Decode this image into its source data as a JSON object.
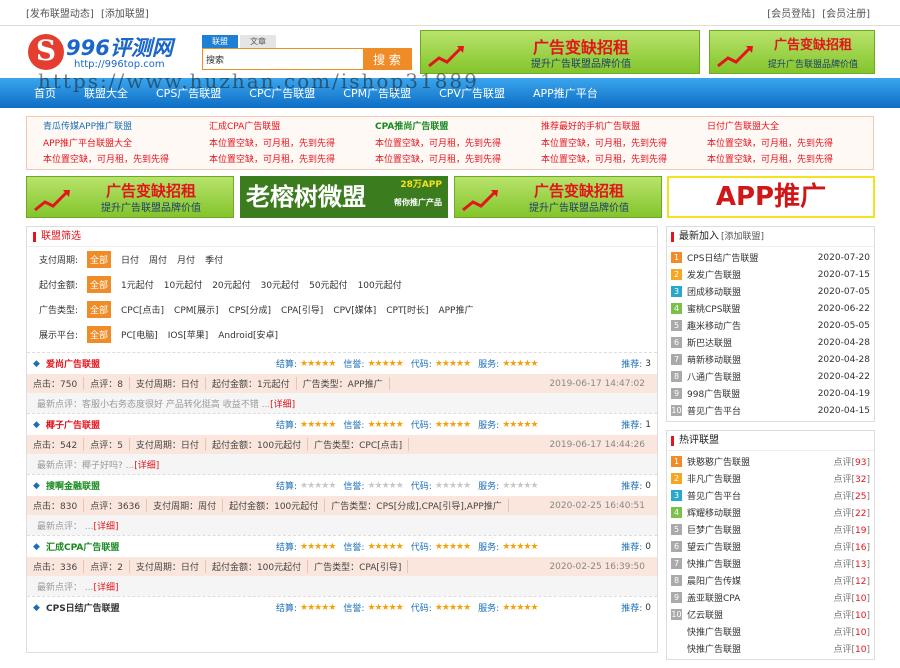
{
  "topbar": {
    "left": [
      "[发布联盟动态]",
      "[添加联盟]"
    ],
    "right": [
      "[会员登陆]",
      "[会员注册]"
    ]
  },
  "logo": {
    "mark": "S",
    "name": "996评测网",
    "url": "http://996top.com"
  },
  "search": {
    "tabs": [
      "联盟",
      "文章"
    ],
    "value": "搜索",
    "button": "搜 索"
  },
  "banner": {
    "title": "广告变缺招租",
    "subtitle": "提升广告联盟品牌价值"
  },
  "nav": {
    "items": [
      "首页",
      "联盟大全",
      "CPS广告联盟",
      "CPC广告联盟",
      "CPM广告联盟",
      "CPV广告联盟",
      "APP推广平台"
    ],
    "watermark": "https://www.huzhan.com/ishop31889"
  },
  "links": [
    "青瓜传媒APP推广联盟",
    "汇成CPA广告联盟",
    "CPA推尚广告联盟",
    "推荐最好的手机广告联盟",
    "日付广告联盟大全",
    "APP推广平台联盟大全",
    "本位置空缺，可月租，先到先得",
    "本位置空缺，可月租，先到先得",
    "本位置空缺，可月租，先到先得",
    "本位置空缺，可月租，先到先得",
    "本位置空缺，可月租，先到先得",
    "本位置空缺，可月租，先到先得",
    "本位置空缺，可月租，先到先得",
    "本位置空缺，可月租，先到先得",
    "本位置空缺，可月租，先到先得"
  ],
  "ads": {
    "green": "老榕树微盟",
    "green_badge": "28万APP",
    "green_sub": "帮你推广产品",
    "app": "APP推广"
  },
  "filter": {
    "title": "联盟筛选",
    "rows": [
      {
        "label": "支付周期:",
        "opts": [
          "全部",
          "日付",
          "周付",
          "月付",
          "季付"
        ]
      },
      {
        "label": "起付金额:",
        "opts": [
          "全部",
          "1元起付",
          "10元起付",
          "20元起付",
          "30元起付",
          "50元起付",
          "100元起付"
        ]
      },
      {
        "label": "广告类型:",
        "opts": [
          "全部",
          "CPC[点击]",
          "CPM[展示]",
          "CPS[分成]",
          "CPA[引导]",
          "CPV[媒体]",
          "CPT[时长]",
          "APP推广"
        ]
      },
      {
        "label": "展示平台:",
        "opts": [
          "全部",
          "PC[电脑]",
          "IOS[苹果]",
          "Android[安卓]"
        ]
      }
    ]
  },
  "labels": {
    "settle": "结算:",
    "credit": "信誉:",
    "code": "代码:",
    "service": "服务:",
    "rec": "推荐:",
    "detail": "[详细]"
  },
  "items": [
    {
      "name": "爱尚广告联盟",
      "stars": "★★★★★",
      "rec": "3",
      "stats": [
        "点击：750",
        "点评：8",
        "支付周期：日付",
        "起付金额：1元起付",
        "广告类型：APP推广"
      ],
      "time": "2019-06-17 14:47:02",
      "comment": "最新点评：客服小右务态度很好  产品转化挺高 收益不错 ..."
    },
    {
      "name": "椰子广告联盟",
      "stars": "★★★★★",
      "rec": "1",
      "stats": [
        "点击：542",
        "点评：5",
        "支付周期：日付",
        "起付金额：100元起付",
        "广告类型：CPC[点击]"
      ],
      "time": "2019-06-17 14:44:26",
      "comment": "最新点评：椰子好吗? ..."
    },
    {
      "name": "搜啊金融联盟",
      "stars": "★★★★★",
      "rec": "0",
      "stats": [
        "点击：830",
        "点评：3636",
        "支付周期：周付",
        "起付金额：100元起付",
        "广告类型：CPS[分成],CPA[引导],APP推广"
      ],
      "time": "2020-02-25 16:40:51",
      "comment": "最新点评： ..."
    },
    {
      "name": "汇成CPA广告联盟",
      "stars": "★★★★★",
      "rec": "0",
      "stats": [
        "点击：336",
        "点评：2",
        "支付周期：日付",
        "起付金额：100元起付",
        "广告类型：CPA[引导]"
      ],
      "time": "2020-02-25 16:39:50",
      "comment": "最新点评： ..."
    },
    {
      "name": "CPS日结广告联盟",
      "stars": "★★★★★",
      "rec": "0"
    }
  ],
  "latest": {
    "title": "最新加入",
    "sub": "[添加联盟]",
    "items": [
      {
        "name": "CPS日结广告联盟",
        "date": "2020-07-20"
      },
      {
        "name": "发发广告联盟",
        "date": "2020-07-15"
      },
      {
        "name": "团成移动联盟",
        "date": "2020-07-05"
      },
      {
        "name": "蜜桃CPS联盟",
        "date": "2020-06-22"
      },
      {
        "name": "趣米移动广告",
        "date": "2020-05-05"
      },
      {
        "name": "斯巴达联盟",
        "date": "2020-04-28"
      },
      {
        "name": "萌新移动联盟",
        "date": "2020-04-28"
      },
      {
        "name": "八通广告联盟",
        "date": "2020-04-22"
      },
      {
        "name": "998广告联盟",
        "date": "2020-04-19"
      },
      {
        "name": "普见广告平台",
        "date": "2020-04-15"
      }
    ]
  },
  "hot": {
    "title": "热评联盟",
    "items": [
      {
        "name": "铁憨憨广告联盟",
        "c": "93"
      },
      {
        "name": "非凡广告联盟",
        "c": "32"
      },
      {
        "name": "普见广告平台",
        "c": "25"
      },
      {
        "name": "辉耀移动联盟",
        "c": "22"
      },
      {
        "name": "巨梦广告联盟",
        "c": "19"
      },
      {
        "name": "望云广告联盟",
        "c": "16"
      },
      {
        "name": "快推广告联盟",
        "c": "13"
      },
      {
        "name": "晨阳广告传媒",
        "c": "12"
      },
      {
        "name": "盖亚联盟CPA",
        "c": "10"
      },
      {
        "name": "亿云联盟",
        "c": "10"
      },
      {
        "name": "快推广告联盟",
        "c": "10"
      },
      {
        "name": "快推广告联盟",
        "c": "10"
      }
    ],
    "cmt_label": "点评"
  }
}
